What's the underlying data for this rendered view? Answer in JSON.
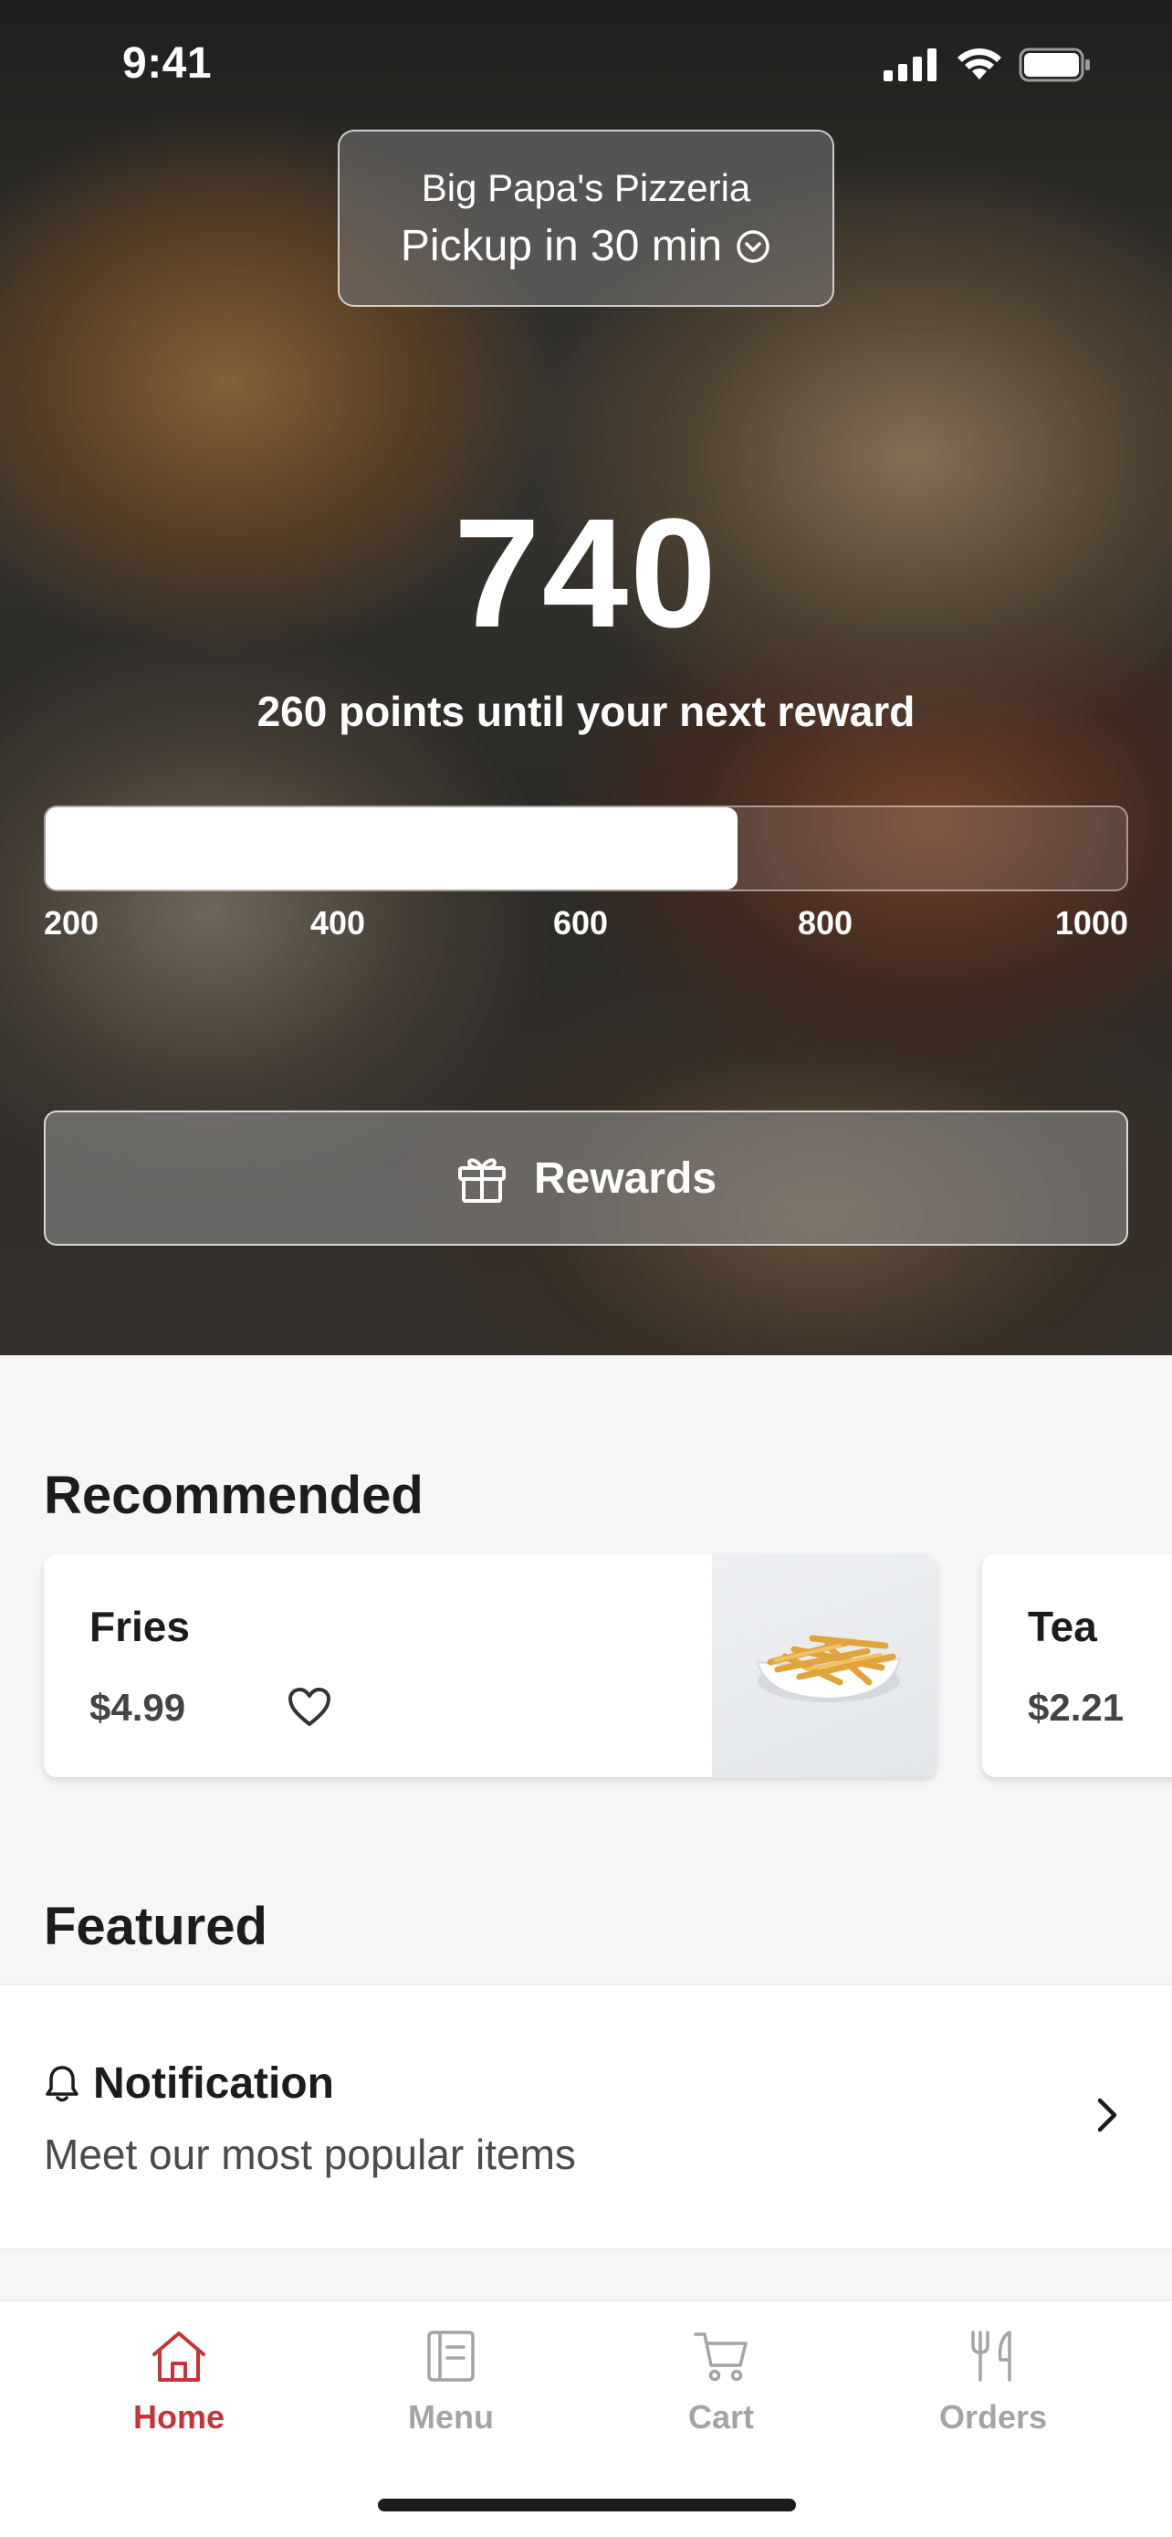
{
  "status_bar": {
    "time": "9:41",
    "icons": [
      "cellular-signal-icon",
      "wifi-icon",
      "battery-icon"
    ]
  },
  "store": {
    "name": "Big Papa's Pizzeria",
    "pickup": "Pickup in 30 min",
    "dropdown_icon": "chevron-down-circle-icon"
  },
  "points": {
    "value": "740",
    "until_next": "260 points until your next reward",
    "progress_fraction": 0.64,
    "ticks": [
      "200",
      "400",
      "600",
      "800",
      "1000"
    ]
  },
  "rewards_button": {
    "label": "Rewards",
    "icon": "gift-icon"
  },
  "recommended": {
    "title": "Recommended",
    "items": [
      {
        "name": "Fries",
        "price": "$4.99",
        "favorite_icon": "heart-icon",
        "image": "fries-photo"
      },
      {
        "name": "Tea",
        "price": "$2.21"
      }
    ]
  },
  "featured": {
    "title": "Featured",
    "notification": {
      "icon": "bell-icon",
      "title": "Notification",
      "subtitle": "Meet our most popular items",
      "chevron": "chevron-right-icon"
    }
  },
  "tab_bar": {
    "tabs": [
      {
        "label": "Home",
        "icon": "home-icon",
        "active": true
      },
      {
        "label": "Menu",
        "icon": "menu-icon",
        "active": false
      },
      {
        "label": "Cart",
        "icon": "cart-icon",
        "active": false
      },
      {
        "label": "Orders",
        "icon": "fork-knife-icon",
        "active": false
      }
    ]
  },
  "colors": {
    "accent": "#c4343a",
    "inactive_tab": "#a4a4a4",
    "background": "#f6f6f6"
  }
}
